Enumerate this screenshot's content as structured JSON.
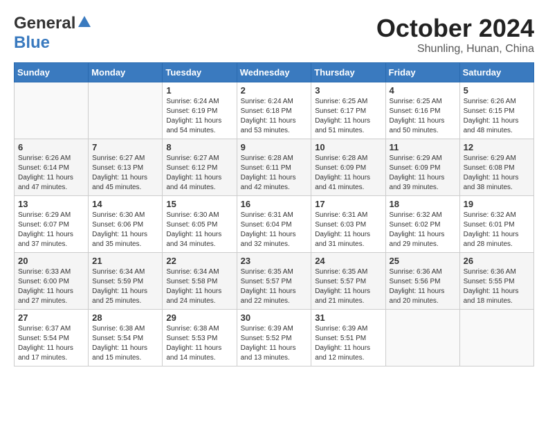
{
  "header": {
    "logo_general": "General",
    "logo_blue": "Blue",
    "month": "October 2024",
    "location": "Shunling, Hunan, China"
  },
  "weekdays": [
    "Sunday",
    "Monday",
    "Tuesday",
    "Wednesday",
    "Thursday",
    "Friday",
    "Saturday"
  ],
  "weeks": [
    [
      {
        "day": "",
        "info": ""
      },
      {
        "day": "",
        "info": ""
      },
      {
        "day": "1",
        "info": "Sunrise: 6:24 AM\nSunset: 6:19 PM\nDaylight: 11 hours and 54 minutes."
      },
      {
        "day": "2",
        "info": "Sunrise: 6:24 AM\nSunset: 6:18 PM\nDaylight: 11 hours and 53 minutes."
      },
      {
        "day": "3",
        "info": "Sunrise: 6:25 AM\nSunset: 6:17 PM\nDaylight: 11 hours and 51 minutes."
      },
      {
        "day": "4",
        "info": "Sunrise: 6:25 AM\nSunset: 6:16 PM\nDaylight: 11 hours and 50 minutes."
      },
      {
        "day": "5",
        "info": "Sunrise: 6:26 AM\nSunset: 6:15 PM\nDaylight: 11 hours and 48 minutes."
      }
    ],
    [
      {
        "day": "6",
        "info": "Sunrise: 6:26 AM\nSunset: 6:14 PM\nDaylight: 11 hours and 47 minutes."
      },
      {
        "day": "7",
        "info": "Sunrise: 6:27 AM\nSunset: 6:13 PM\nDaylight: 11 hours and 45 minutes."
      },
      {
        "day": "8",
        "info": "Sunrise: 6:27 AM\nSunset: 6:12 PM\nDaylight: 11 hours and 44 minutes."
      },
      {
        "day": "9",
        "info": "Sunrise: 6:28 AM\nSunset: 6:11 PM\nDaylight: 11 hours and 42 minutes."
      },
      {
        "day": "10",
        "info": "Sunrise: 6:28 AM\nSunset: 6:09 PM\nDaylight: 11 hours and 41 minutes."
      },
      {
        "day": "11",
        "info": "Sunrise: 6:29 AM\nSunset: 6:09 PM\nDaylight: 11 hours and 39 minutes."
      },
      {
        "day": "12",
        "info": "Sunrise: 6:29 AM\nSunset: 6:08 PM\nDaylight: 11 hours and 38 minutes."
      }
    ],
    [
      {
        "day": "13",
        "info": "Sunrise: 6:29 AM\nSunset: 6:07 PM\nDaylight: 11 hours and 37 minutes."
      },
      {
        "day": "14",
        "info": "Sunrise: 6:30 AM\nSunset: 6:06 PM\nDaylight: 11 hours and 35 minutes."
      },
      {
        "day": "15",
        "info": "Sunrise: 6:30 AM\nSunset: 6:05 PM\nDaylight: 11 hours and 34 minutes."
      },
      {
        "day": "16",
        "info": "Sunrise: 6:31 AM\nSunset: 6:04 PM\nDaylight: 11 hours and 32 minutes."
      },
      {
        "day": "17",
        "info": "Sunrise: 6:31 AM\nSunset: 6:03 PM\nDaylight: 11 hours and 31 minutes."
      },
      {
        "day": "18",
        "info": "Sunrise: 6:32 AM\nSunset: 6:02 PM\nDaylight: 11 hours and 29 minutes."
      },
      {
        "day": "19",
        "info": "Sunrise: 6:32 AM\nSunset: 6:01 PM\nDaylight: 11 hours and 28 minutes."
      }
    ],
    [
      {
        "day": "20",
        "info": "Sunrise: 6:33 AM\nSunset: 6:00 PM\nDaylight: 11 hours and 27 minutes."
      },
      {
        "day": "21",
        "info": "Sunrise: 6:34 AM\nSunset: 5:59 PM\nDaylight: 11 hours and 25 minutes."
      },
      {
        "day": "22",
        "info": "Sunrise: 6:34 AM\nSunset: 5:58 PM\nDaylight: 11 hours and 24 minutes."
      },
      {
        "day": "23",
        "info": "Sunrise: 6:35 AM\nSunset: 5:57 PM\nDaylight: 11 hours and 22 minutes."
      },
      {
        "day": "24",
        "info": "Sunrise: 6:35 AM\nSunset: 5:57 PM\nDaylight: 11 hours and 21 minutes."
      },
      {
        "day": "25",
        "info": "Sunrise: 6:36 AM\nSunset: 5:56 PM\nDaylight: 11 hours and 20 minutes."
      },
      {
        "day": "26",
        "info": "Sunrise: 6:36 AM\nSunset: 5:55 PM\nDaylight: 11 hours and 18 minutes."
      }
    ],
    [
      {
        "day": "27",
        "info": "Sunrise: 6:37 AM\nSunset: 5:54 PM\nDaylight: 11 hours and 17 minutes."
      },
      {
        "day": "28",
        "info": "Sunrise: 6:38 AM\nSunset: 5:54 PM\nDaylight: 11 hours and 15 minutes."
      },
      {
        "day": "29",
        "info": "Sunrise: 6:38 AM\nSunset: 5:53 PM\nDaylight: 11 hours and 14 minutes."
      },
      {
        "day": "30",
        "info": "Sunrise: 6:39 AM\nSunset: 5:52 PM\nDaylight: 11 hours and 13 minutes."
      },
      {
        "day": "31",
        "info": "Sunrise: 6:39 AM\nSunset: 5:51 PM\nDaylight: 11 hours and 12 minutes."
      },
      {
        "day": "",
        "info": ""
      },
      {
        "day": "",
        "info": ""
      }
    ]
  ]
}
